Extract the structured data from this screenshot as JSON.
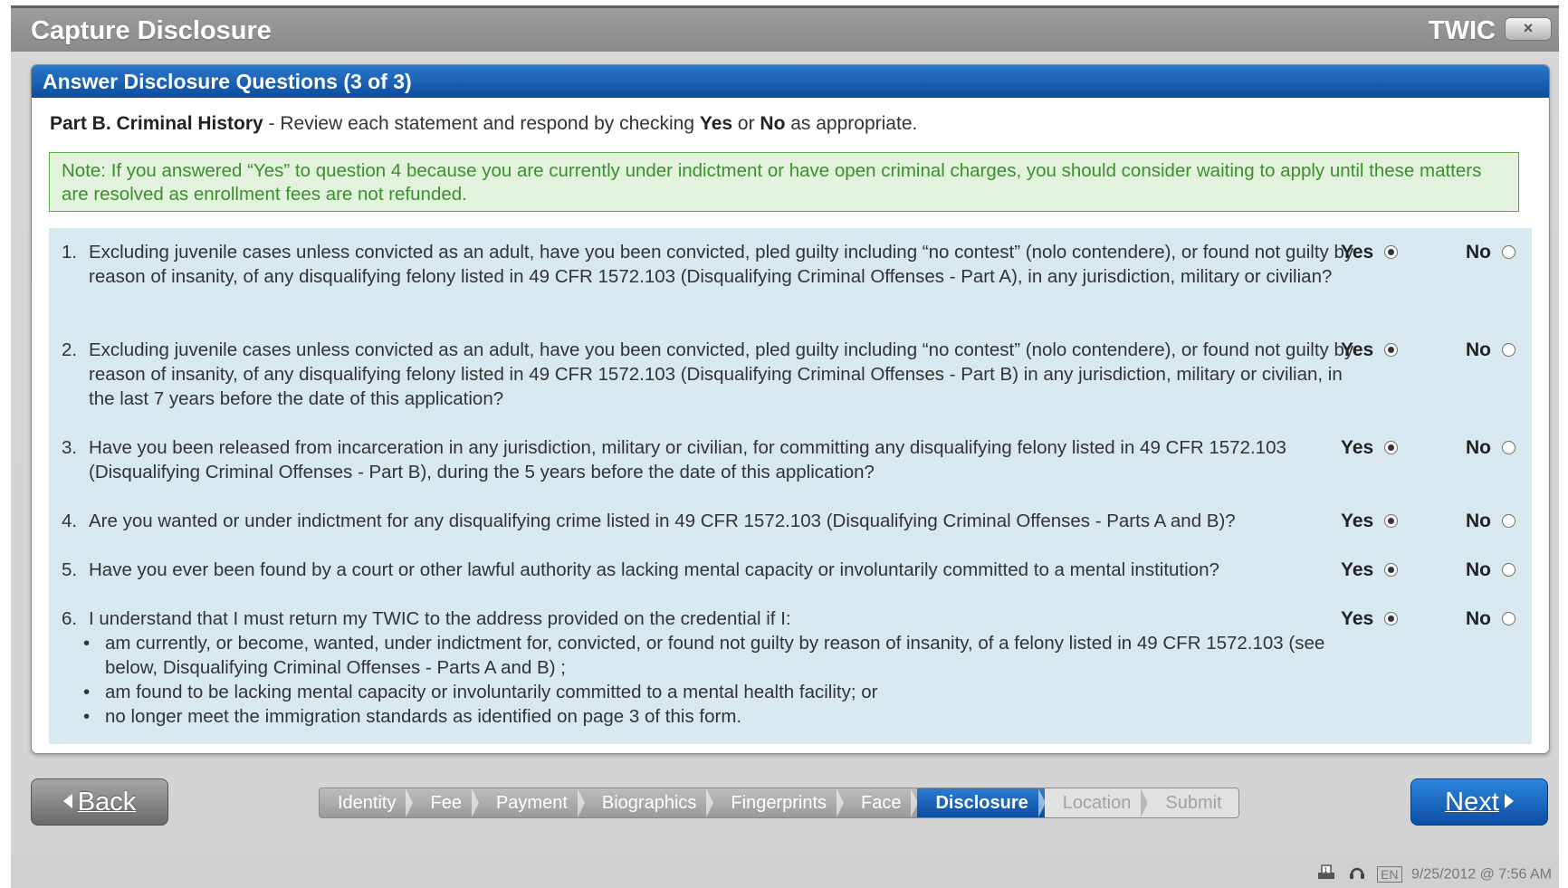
{
  "window": {
    "title": "Capture Disclosure",
    "brand": "TWIC",
    "close_label": "×"
  },
  "panel": {
    "header": "Answer Disclosure Questions (3 of 3)",
    "part_title": "Part B. Criminal History",
    "instruction_pre": " - Review each statement and respond by checking ",
    "instruction_yes": "Yes",
    "instruction_or": " or ",
    "instruction_no": "No",
    "instruction_post": " as appropriate.",
    "note": "Note: If you answered “Yes” to question 4 because you are currently under indictment or have open criminal charges, you should consider waiting to apply until these matters are resolved as enrollment fees are not refunded."
  },
  "questions": [
    {
      "num": "1.",
      "text": "Excluding juvenile cases unless convicted as an adult, have you been convicted, pled guilty including “no contest” (nolo contendere), or found not guilty by reason of insanity, of any disqualifying felony listed in 49 CFR 1572.103 (Disqualifying Criminal Offenses - Part A), in any jurisdiction, military or civilian?",
      "yes_label": "Yes",
      "no_label": "No",
      "selected": "Yes"
    },
    {
      "num": "2.",
      "text": "Excluding juvenile cases unless convicted as an adult, have you been convicted, pled guilty including “no contest” (nolo contendere), or found not guilty by reason of insanity, of any disqualifying felony listed in 49 CFR 1572.103 (Disqualifying Criminal Offenses - Part B) in any jurisdiction, military or civilian, in the last 7 years before the date of this application?",
      "yes_label": "Yes",
      "no_label": "No",
      "selected": "Yes"
    },
    {
      "num": "3.",
      "text": "Have you been released from incarceration in any jurisdiction, military or civilian, for committing any disqualifying felony listed in 49 CFR 1572.103 (Disqualifying Criminal Offenses - Part B), during the 5 years before the date of this application?",
      "yes_label": "Yes",
      "no_label": "No",
      "selected": "Yes"
    },
    {
      "num": "4.",
      "text": "Are you wanted or under indictment for any disqualifying crime listed in 49 CFR 1572.103 (Disqualifying Criminal Offenses - Parts A and B)?",
      "yes_label": "Yes",
      "no_label": "No",
      "selected": "Yes"
    },
    {
      "num": "5.",
      "text": "Have you ever been found by a court or other lawful authority as lacking mental capacity or involuntarily committed to a mental institution?",
      "yes_label": "Yes",
      "no_label": "No",
      "selected": "Yes"
    },
    {
      "num": "6.",
      "text": "I understand that I must return my TWIC to the address provided on the credential if I:",
      "bullets": [
        "am currently, or become, wanted, under indictment for, convicted, or found not guilty by reason of insanity, of a felony listed in 49 CFR 1572.103 (see below, Disqualifying Criminal Offenses - Parts A and B) ;",
        "am found to be lacking mental capacity or involuntarily committed to a mental health facility; or",
        "no longer meet the immigration standards as identified on page 3 of this form."
      ],
      "yes_label": "Yes",
      "no_label": "No",
      "selected": "Yes"
    }
  ],
  "footer": {
    "back_label": "Back",
    "next_label": "Next",
    "steps": [
      {
        "label": "Identity",
        "state": "done"
      },
      {
        "label": "Fee",
        "state": "done"
      },
      {
        "label": "Payment",
        "state": "done"
      },
      {
        "label": "Biographics",
        "state": "done"
      },
      {
        "label": "Fingerprints",
        "state": "done"
      },
      {
        "label": "Face",
        "state": "done"
      },
      {
        "label": "Disclosure",
        "state": "active"
      },
      {
        "label": "Location",
        "state": "future"
      },
      {
        "label": "Submit",
        "state": "future"
      }
    ]
  },
  "status": {
    "language": "EN",
    "datetime": "9/25/2012 @ 7:56 AM",
    "icons": [
      "printer-icon",
      "headset-icon"
    ]
  },
  "colors": {
    "header_blue": "#0d4d9c",
    "note_green": "#3c8f2e",
    "question_bg": "#d8e8ef"
  }
}
